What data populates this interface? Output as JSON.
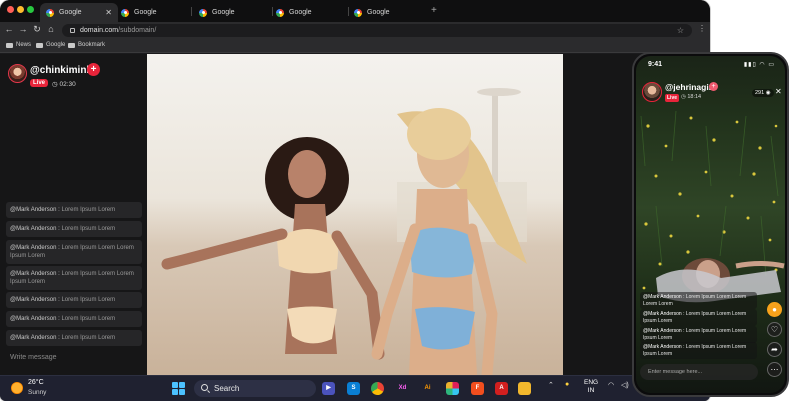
{
  "browser": {
    "tabs": [
      {
        "label": "Google",
        "active": true
      },
      {
        "label": "Google"
      },
      {
        "label": "Google"
      },
      {
        "label": "Google"
      },
      {
        "label": "Google"
      }
    ],
    "tab_close": "✕",
    "new_tab": "+",
    "address": {
      "domain": "domain.com",
      "path": "/subdomain/"
    },
    "bookmarks": [
      "News",
      "Google",
      "Bookmark"
    ]
  },
  "stream": {
    "username": "@chinkiminki",
    "live_label": "Live",
    "duration": "02:30",
    "follow_symbol": "+",
    "comments": [
      {
        "user": "@Mark Anderson :",
        "text": "Lorem Ipsum Lorem"
      },
      {
        "user": "@Mark Anderson :",
        "text": "Lorem Ipsum Lorem"
      },
      {
        "user": "@Mark Anderson :",
        "text": "Lorem Ipsum Lorem Lorem Ipsum Lorem"
      },
      {
        "user": "@Mark Anderson :",
        "text": "Lorem Ipsum Lorem Lorem Ipsum Lorem"
      },
      {
        "user": "@Mark Anderson :",
        "text": "Lorem Ipsum Lorem"
      },
      {
        "user": "@Mark Anderson :",
        "text": "Lorem Ipsum Lorem"
      },
      {
        "user": "@Mark Anderson :",
        "text": "Lorem Ipsum Lorem"
      }
    ],
    "write_placeholder": "Write message"
  },
  "taskbar": {
    "temperature": "26°C",
    "weather": "Sunny",
    "search_label": "Search",
    "lang_line1": "ENG",
    "lang_line2": "IN",
    "apps": [
      {
        "name": "Xd",
        "color": "#470137",
        "fg": "#ff61f6"
      },
      {
        "name": "Ai",
        "color": "#330000",
        "fg": "#ff9a00"
      }
    ],
    "colors": {
      "accent": "#4cc2ff"
    }
  },
  "phone": {
    "time": "9:41",
    "username": "@jehrinagin",
    "live_label": "Live",
    "duration": "18:14",
    "viewers": "291",
    "close": "✕",
    "comments": [
      {
        "user": "@Mark Anderson :",
        "text": "Lorem Ipsum Lorem Lorem Lorem Lorem"
      },
      {
        "user": "@Mark Anderson :",
        "text": "Lorem Ipsum Lorem Lorem Ipsum Lorem"
      },
      {
        "user": "@Mark Anderson :",
        "text": "Lorem Ipsum Lorem Lorem Ipsum Lorem"
      },
      {
        "user": "@Mark Anderson :",
        "text": "Lorem Ipsum Lorem Lorem Ipsum Lorem"
      },
      {
        "user": "@Mark Anderson :",
        "text": "Lorem Ipsum Lorem Lorem Lorem"
      }
    ],
    "input_placeholder": "Enter message here..."
  },
  "colors": {
    "live_red": "#e8243a",
    "panel_bg": "#161617"
  }
}
